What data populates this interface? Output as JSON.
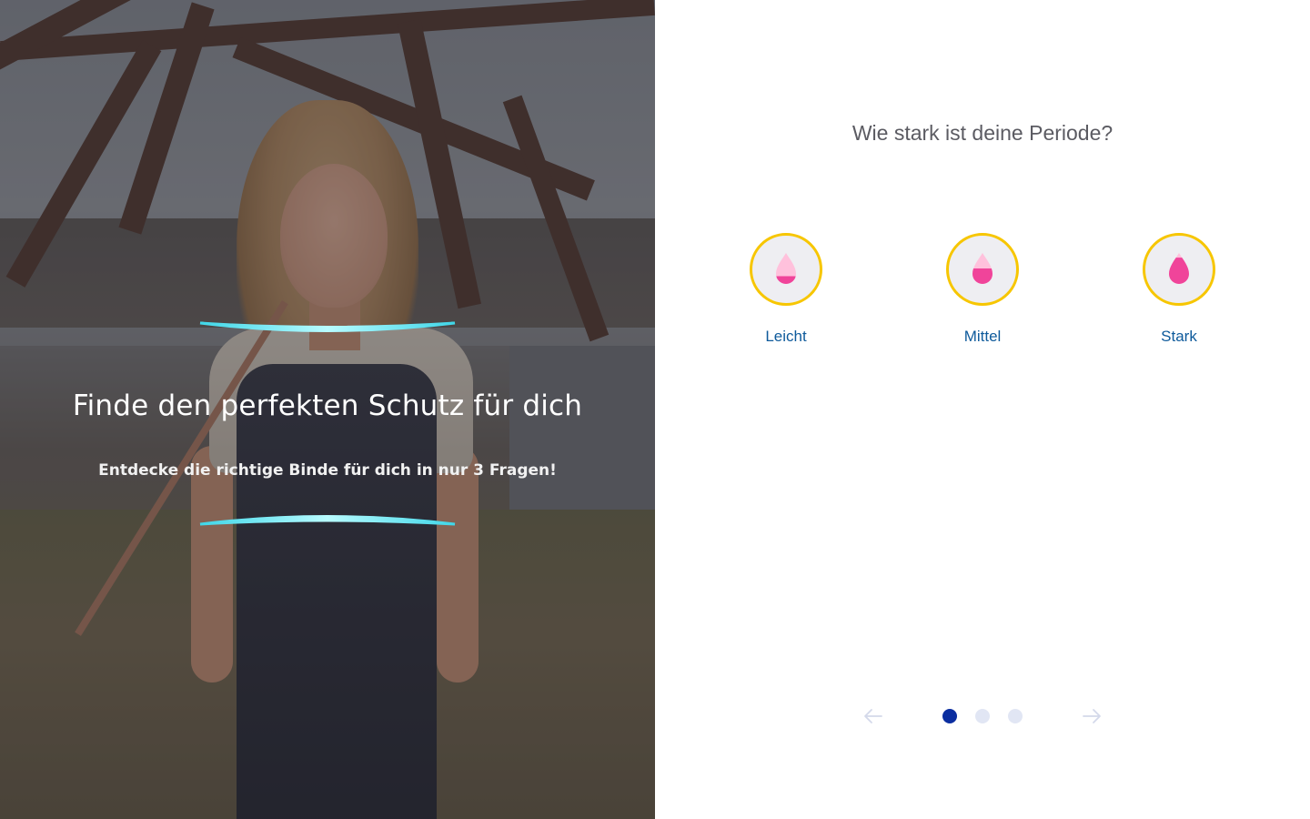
{
  "hero": {
    "title": "Finde den perfekten Schutz für dich",
    "subtitle": "Entdecke die richtige Binde für dich in nur 3 Fragen!",
    "arc_color": "#6fe6f2",
    "image_description_icon": "woman-under-bridge-photo"
  },
  "quiz": {
    "question": "Wie stark ist deine Periode?",
    "options": [
      {
        "label": "Leicht",
        "icon": "drop-light-icon",
        "fill_level": 0.25
      },
      {
        "label": "Mittel",
        "icon": "drop-medium-icon",
        "fill_level": 0.5
      },
      {
        "label": "Stark",
        "icon": "drop-heavy-icon",
        "fill_level": 0.85
      }
    ],
    "ring_color": "#f7c600",
    "label_color": "#0e5a9b",
    "drop_color": "#ffc1dc",
    "drop_fill_color": "#f0449a"
  },
  "pager": {
    "current_step": 1,
    "total_steps": 3,
    "active_color": "#0b2ea0",
    "inactive_color": "#e1e6f4",
    "prev_icon": "arrow-left-icon",
    "next_icon": "arrow-right-icon"
  }
}
